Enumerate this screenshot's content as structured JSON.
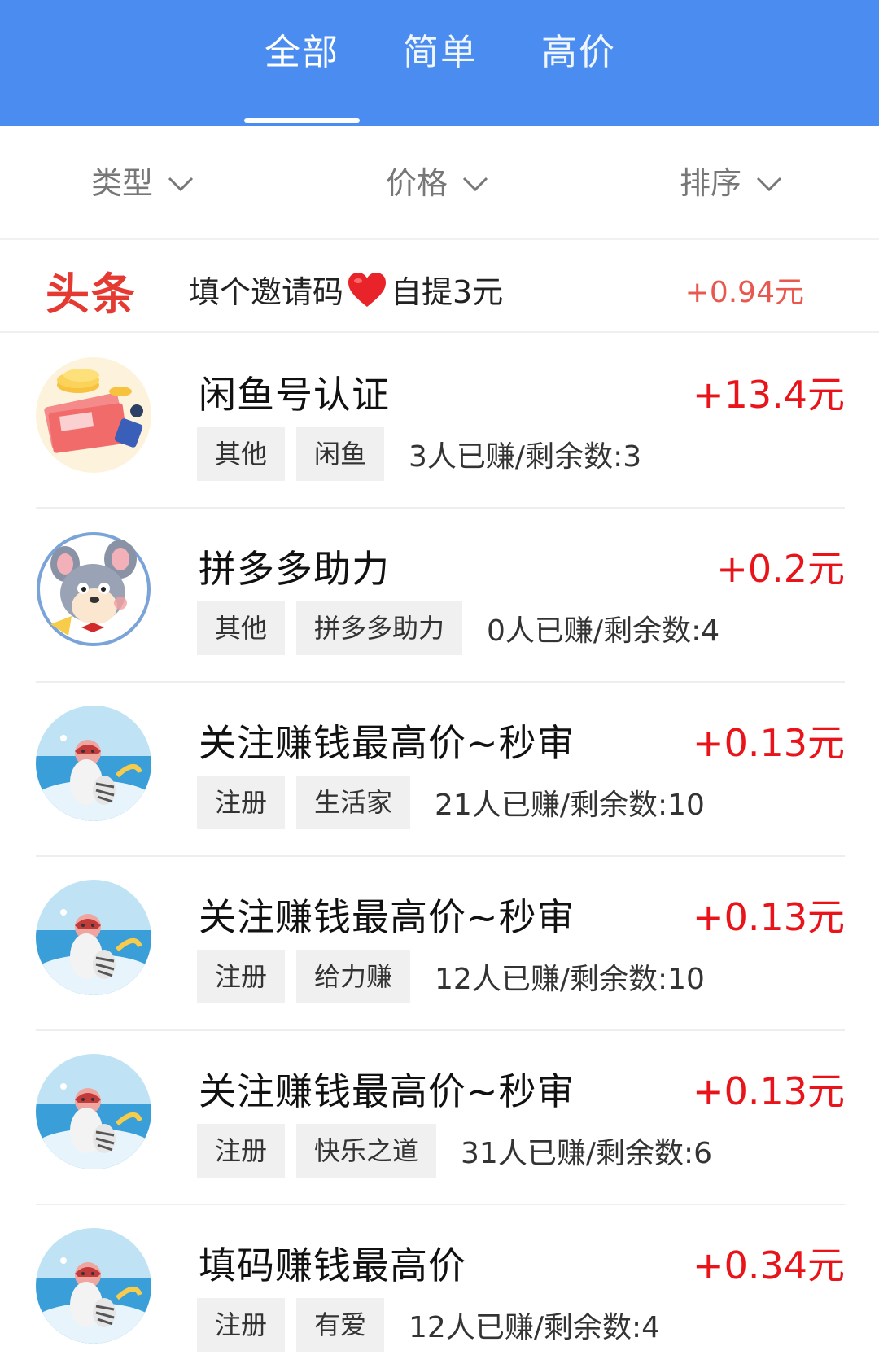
{
  "tabs": [
    {
      "label": "全部",
      "active": true
    },
    {
      "label": "简单"
    },
    {
      "label": "高价"
    }
  ],
  "filters": [
    {
      "label": "类型"
    },
    {
      "label": "价格"
    },
    {
      "label": "排序"
    }
  ],
  "headline": {
    "logo_text": "头条",
    "text_before": "填个邀请码",
    "text_after": "自提3元",
    "price": "+0.94元"
  },
  "tasks": [
    {
      "title": "闲鱼号认证",
      "price": "+13.4元",
      "tags": [
        "其他",
        "闲鱼"
      ],
      "stats": "3人已赚/剩余数:3",
      "avatar": "money-coins-avatar"
    },
    {
      "title": "拼多多助力",
      "price": "+0.2元",
      "tags": [
        "其他",
        "拼多多助力"
      ],
      "stats": "0人已赚/剩余数:4",
      "avatar": "cartoon-mouse-avatar"
    },
    {
      "title": "关注赚钱最高价~秒审",
      "price": "+0.13元",
      "tags": [
        "注册",
        "生活家"
      ],
      "stats": "21人已赚/剩余数:10",
      "avatar": "cartoon-cat-avatar"
    },
    {
      "title": "关注赚钱最高价~秒审",
      "price": "+0.13元",
      "tags": [
        "注册",
        "给力赚"
      ],
      "stats": "12人已赚/剩余数:10",
      "avatar": "cartoon-cat-avatar"
    },
    {
      "title": "关注赚钱最高价~秒审",
      "price": "+0.13元",
      "tags": [
        "注册",
        "快乐之道"
      ],
      "stats": "31人已赚/剩余数:6",
      "avatar": "cartoon-cat-avatar"
    },
    {
      "title": "填码赚钱最高价",
      "price": "+0.34元",
      "tags": [
        "注册",
        "有爱"
      ],
      "stats": "12人已赚/剩余数:4",
      "avatar": "cartoon-cat-avatar"
    }
  ],
  "colors": {
    "header_blue": "#4b8cf0",
    "price_red": "#e8141a",
    "headline_red": "#e53a32"
  }
}
